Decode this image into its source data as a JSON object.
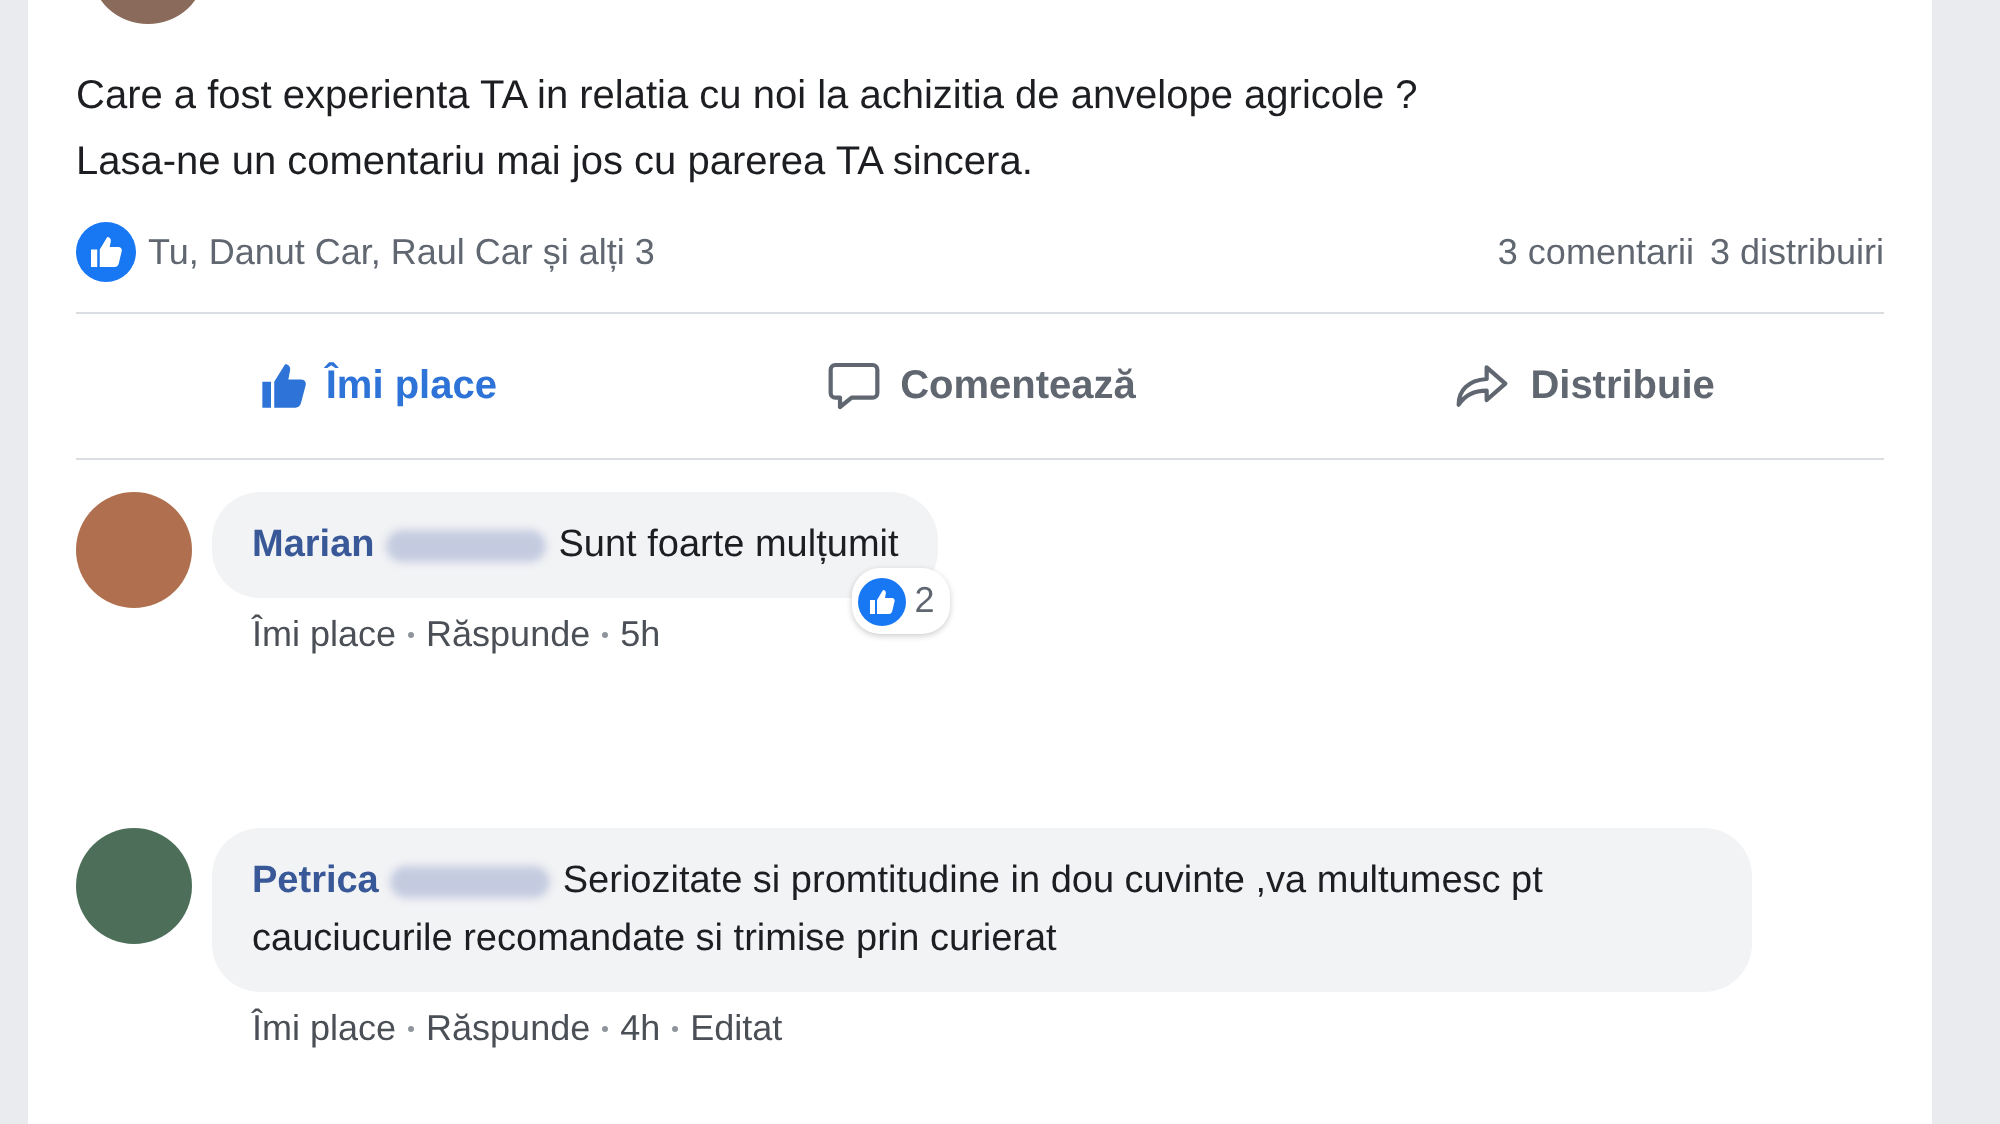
{
  "post": {
    "text_lines": [
      "Care a fost experienta TA in relatia cu noi la achizitia de anvelope agricole ?",
      "Lasa-ne un comentariu mai jos cu parerea TA sincera."
    ]
  },
  "reactions": {
    "summary": "Tu, Danut Car, Raul Car și alți 3",
    "comments_count": "3 comentarii",
    "shares_count": "3 distribuiri"
  },
  "actions": [
    {
      "kind": "like",
      "label": "Îmi place",
      "selected": true
    },
    {
      "kind": "comment",
      "label": "Comentează",
      "selected": false
    },
    {
      "kind": "share",
      "label": "Distribuie",
      "selected": false
    }
  ],
  "comments": [
    {
      "author": "Marian",
      "text": "Sunt foarte mulțumit",
      "reaction_count": "2",
      "actions": [
        "Îmi place",
        "Răspunde",
        "5h"
      ]
    },
    {
      "author": "Petrica",
      "text": "Seriozitate si promtitudine in dou cuvinte ,va multumesc pt cauciucurile recomandate si trimise prin curierat",
      "actions": [
        "Îmi place",
        "Răspunde",
        "4h",
        "Editat"
      ]
    }
  ]
}
